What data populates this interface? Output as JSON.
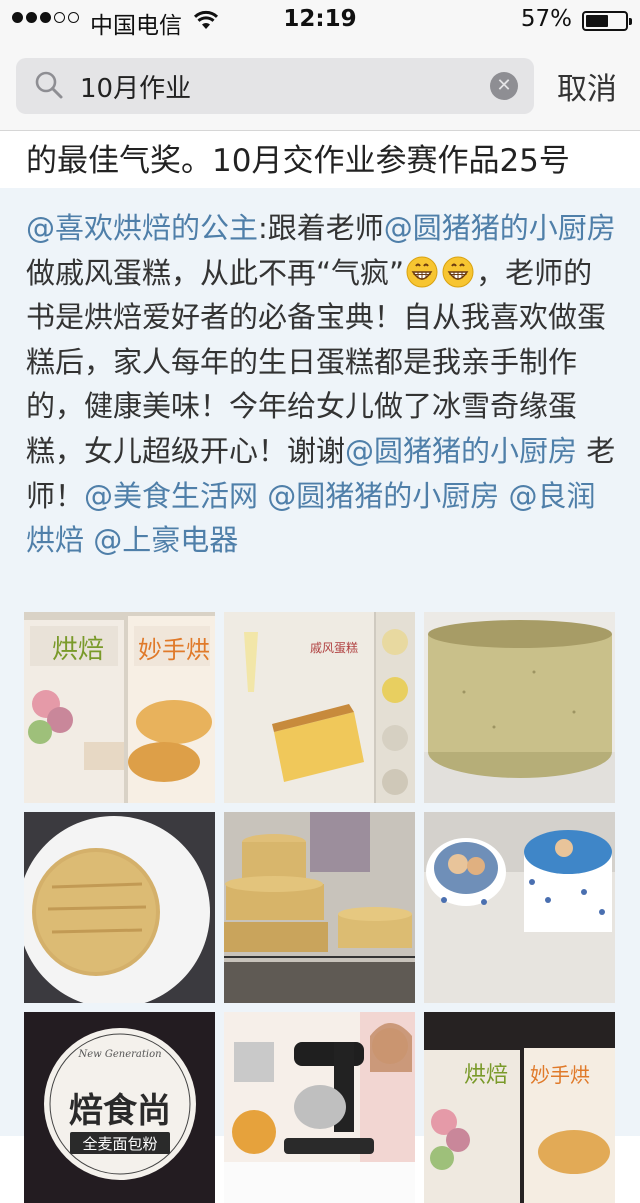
{
  "status_bar": {
    "carrier": "中国电信",
    "time": "12:19",
    "battery_percent": "57%",
    "battery_level": 0.57,
    "signal_bars_on": 3,
    "signal_bars_total": 5
  },
  "search": {
    "query": "10月作业",
    "cancel_label": "取消",
    "icons": [
      "search-icon",
      "clear-icon"
    ]
  },
  "previous_result": {
    "text": "的最佳气奖。10月交作业参赛作品25号"
  },
  "post": {
    "segments": [
      {
        "t": "@喜欢烘焙的公主",
        "m": true
      },
      {
        "t": ":跟着老师"
      },
      {
        "t": "@圆猪猪的小厨房",
        "m": true
      },
      {
        "t": " 做戚风蛋糕，从此不再“气疯”"
      },
      {
        "emoji": "grin"
      },
      {
        "emoji": "grin"
      },
      {
        "t": "，老师的书是烘焙爱好者的必备宝典！自从我喜欢做蛋糕后，家人每年的生日蛋糕都是我亲手制作的，健康美味！今年给女儿做了冰雪奇缘蛋糕，女儿超级开心！谢谢"
      },
      {
        "t": "@圆猪猪的小厨房",
        "m": true
      },
      {
        "t": " 老师！"
      },
      {
        "t": "@美食生活网",
        "m": true
      },
      {
        "t": " "
      },
      {
        "t": "@圆猪猪的小厨房",
        "m": true
      },
      {
        "t": " "
      },
      {
        "t": "@良润烘焙",
        "m": true
      },
      {
        "t": " "
      },
      {
        "t": "@上豪电器",
        "m": true
      }
    ],
    "mention_color": "#4f7fa9",
    "card_background": "#eef4f9"
  },
  "photos": [
    {
      "name": "photo-baking-book-covers",
      "icon": "photo"
    },
    {
      "name": "photo-chiffon-recipe-page",
      "icon": "photo"
    },
    {
      "name": "photo-chiffon-cake-closeup",
      "icon": "photo"
    },
    {
      "name": "photo-cake-on-plate",
      "icon": "photo"
    },
    {
      "name": "photo-stacked-cakes-on-rack",
      "icon": "photo"
    },
    {
      "name": "photo-frozen-themed-cakes",
      "icon": "photo"
    },
    {
      "name": "photo-bread-flour-logo",
      "icon": "photo",
      "logo_text": [
        "焙食尚",
        "全麦面包粉"
      ]
    },
    {
      "name": "photo-stand-mixer-ad",
      "icon": "photo"
    },
    {
      "name": "photo-baking-book-covers-2",
      "icon": "photo"
    }
  ]
}
